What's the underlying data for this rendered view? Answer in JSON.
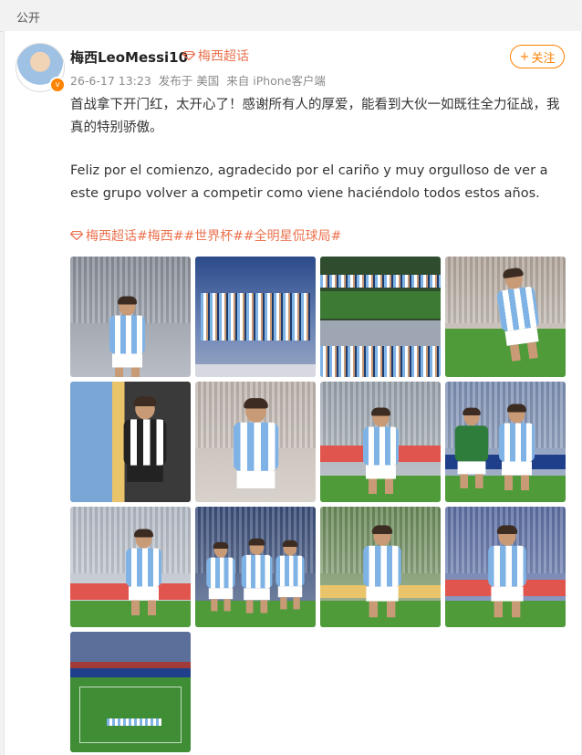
{
  "visibility": "公开",
  "user": {
    "name": "梅西LeoMessi10",
    "supertopic": "梅西超话",
    "verified_badge": "v"
  },
  "meta": {
    "timestamp": "26-6-17 13:23",
    "location": "发布于 美国",
    "source": "来自 iPhone客户端"
  },
  "follow_button": {
    "label": "关注",
    "icon": "+"
  },
  "post": {
    "text_zh": "首战拿下开门红，太开心了！感谢所有人的厚爱，能看到大伙一如既往全力征战，我真的特别骄傲。",
    "text_es": "Feliz por el comienzo, agradecido por el cariño y muy orgulloso de ver a este grupo volver a competir como viene haciéndolo todos estos años.",
    "tags": "梅西超话#梅西##世界杯##全明星侃球局#"
  },
  "photos": [
    {
      "name": "photo-1",
      "scene": "celebrating-fists"
    },
    {
      "name": "photo-2",
      "scene": "team-tunnel"
    },
    {
      "name": "photo-3",
      "scene": "team-lineup-grid"
    },
    {
      "name": "photo-4",
      "scene": "kicking-ball"
    },
    {
      "name": "photo-5",
      "scene": "training-shirt"
    },
    {
      "name": "photo-6",
      "scene": "arms-open-celebration"
    },
    {
      "name": "photo-7",
      "scene": "walking-pitch"
    },
    {
      "name": "photo-8",
      "scene": "dribbling-vs-defender"
    },
    {
      "name": "photo-9",
      "scene": "back-number-10"
    },
    {
      "name": "photo-10",
      "scene": "team-huddle"
    },
    {
      "name": "photo-11",
      "scene": "running-with-ball"
    },
    {
      "name": "photo-12",
      "scene": "celebrating-stadium"
    },
    {
      "name": "photo-13",
      "scene": "stadium-wide-view"
    }
  ],
  "colors": {
    "accent": "#ff8200",
    "link": "#eb7350",
    "argentina_blue": "#7fb3e6"
  }
}
